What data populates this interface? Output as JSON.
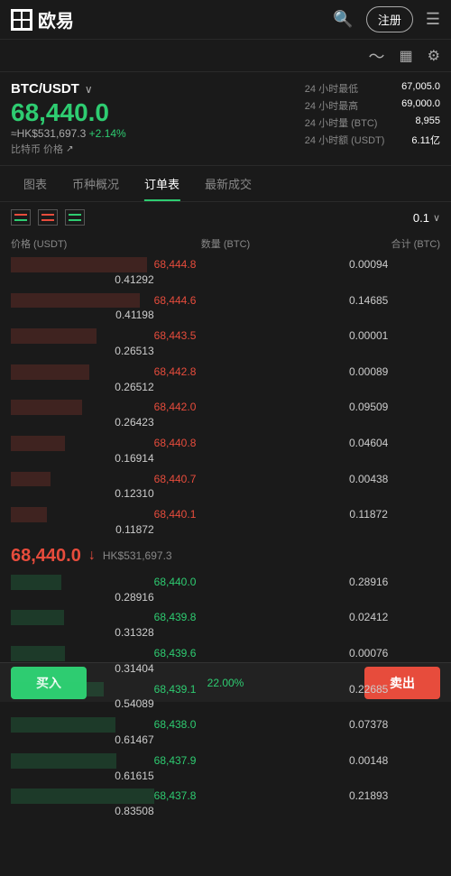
{
  "header": {
    "logo_text": "欧易",
    "register_label": "注册",
    "icons": [
      "search",
      "register",
      "menu"
    ]
  },
  "sub_header": {
    "icons": [
      "chart-line",
      "document",
      "settings"
    ]
  },
  "pair": {
    "name": "BTC/USDT",
    "main_price": "68,440.0",
    "hk_price": "≈HK$531,697.3",
    "change_pct": "+2.14%",
    "coin_label": "比特币 价格",
    "stats": [
      {
        "label": "24 小时最低",
        "value": "67,005.0"
      },
      {
        "label": "24 小时最高",
        "value": "69,000.0"
      },
      {
        "label": "24 小时量 (BTC)",
        "value": "8,955"
      },
      {
        "label": "24 小时额 (USDT)",
        "value": "6.11亿"
      }
    ]
  },
  "tabs": [
    "图表",
    "币种概况",
    "订单表",
    "最新成交"
  ],
  "active_tab_index": 2,
  "ob_controls": {
    "decimal_value": "0.1"
  },
  "ob_header": {
    "col1": "价格 (USDT)",
    "col2": "数量 (BTC)",
    "col3": "合计 (BTC)"
  },
  "sell_orders": [
    {
      "price": "68,444.8",
      "qty": "0.00094",
      "total": "0.41292",
      "bar_pct": 95
    },
    {
      "price": "68,444.6",
      "qty": "0.14685",
      "total": "0.41198",
      "bar_pct": 90
    },
    {
      "price": "68,443.5",
      "qty": "0.00001",
      "total": "0.26513",
      "bar_pct": 60
    },
    {
      "price": "68,442.8",
      "qty": "0.00089",
      "total": "0.26512",
      "bar_pct": 55
    },
    {
      "price": "68,442.0",
      "qty": "0.09509",
      "total": "0.26423",
      "bar_pct": 50
    },
    {
      "price": "68,440.8",
      "qty": "0.04604",
      "total": "0.16914",
      "bar_pct": 38
    },
    {
      "price": "68,440.7",
      "qty": "0.00438",
      "total": "0.12310",
      "bar_pct": 28
    },
    {
      "price": "68,440.1",
      "qty": "0.11872",
      "total": "0.11872",
      "bar_pct": 25
    }
  ],
  "mid_price": {
    "value": "68,440.0",
    "arrow": "↓",
    "hk": "HK$531,697.3"
  },
  "buy_orders": [
    {
      "price": "68,440.0",
      "qty": "0.28916",
      "total": "0.28916",
      "bar_pct": 35
    },
    {
      "price": "68,439.8",
      "qty": "0.02412",
      "total": "0.31328",
      "bar_pct": 37
    },
    {
      "price": "68,439.6",
      "qty": "0.00076",
      "total": "0.31404",
      "bar_pct": 38
    },
    {
      "price": "68,439.1",
      "qty": "0.22685",
      "total": "0.54089",
      "bar_pct": 65
    },
    {
      "price": "68,438.0",
      "qty": "0.07378",
      "total": "0.61467",
      "bar_pct": 73
    },
    {
      "price": "68,437.9",
      "qty": "0.00148",
      "total": "0.61615",
      "bar_pct": 74
    },
    {
      "price": "68,437.8",
      "qty": "0.21893",
      "total": "0.83508",
      "bar_pct": 100
    }
  ],
  "bottom": {
    "buy_label": "买入",
    "sell_label": "卖出",
    "pct_label": "22.00%"
  }
}
